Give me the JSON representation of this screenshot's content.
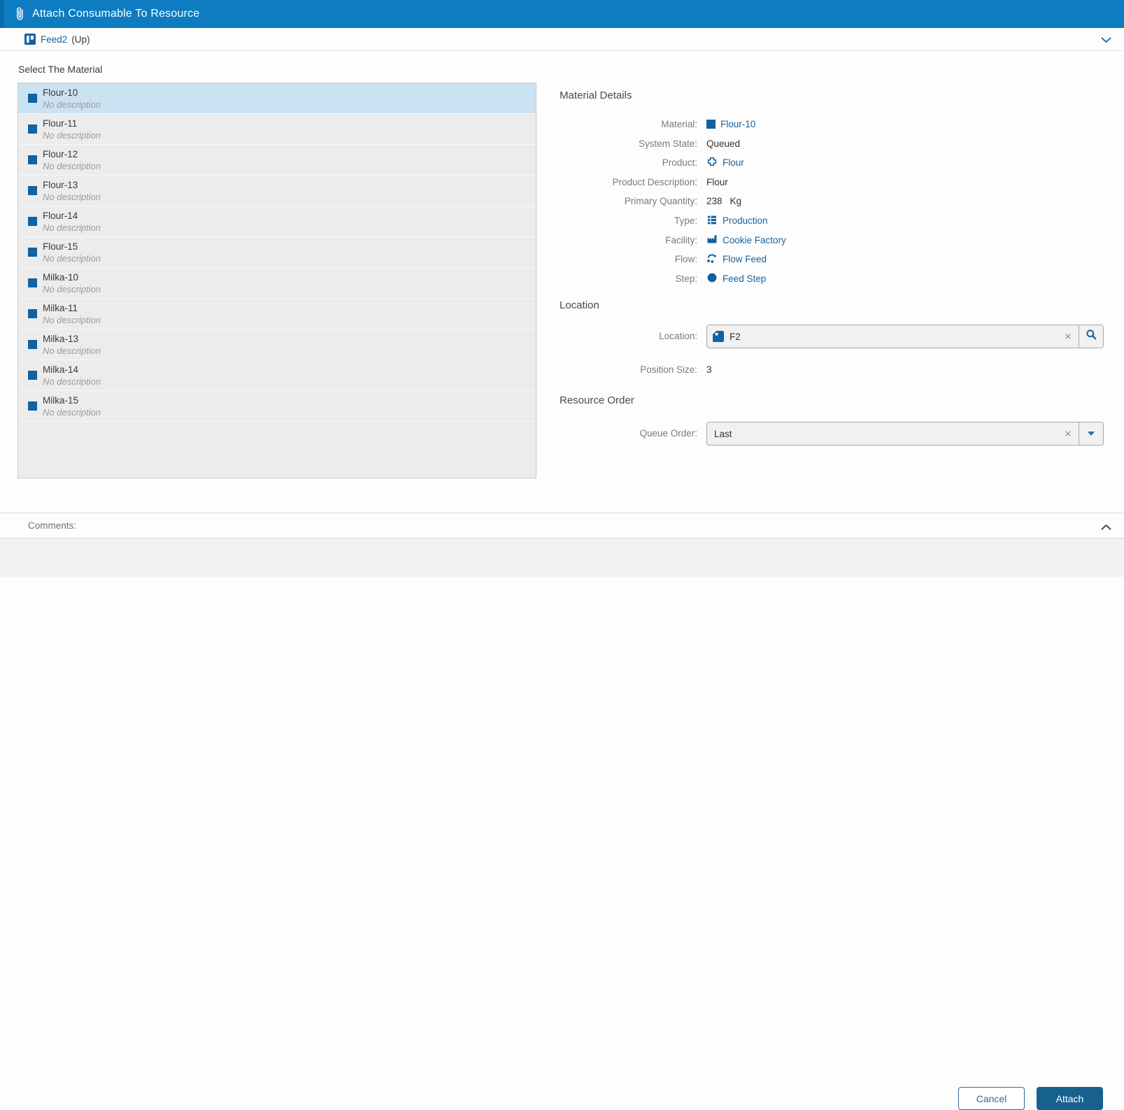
{
  "titlebar": {
    "title": "Attach Consumable To Resource"
  },
  "context": {
    "resource_name": "Feed2",
    "resource_state": "(Up)"
  },
  "materials": {
    "heading": "Select The Material",
    "items": [
      {
        "name": "Flour-10",
        "description": "No description",
        "selected": true
      },
      {
        "name": "Flour-11",
        "description": "No description",
        "selected": false
      },
      {
        "name": "Flour-12",
        "description": "No description",
        "selected": false
      },
      {
        "name": "Flour-13",
        "description": "No description",
        "selected": false
      },
      {
        "name": "Flour-14",
        "description": "No description",
        "selected": false
      },
      {
        "name": "Flour-15",
        "description": "No description",
        "selected": false
      },
      {
        "name": "Milka-10",
        "description": "No description",
        "selected": false
      },
      {
        "name": "Milka-11",
        "description": "No description",
        "selected": false
      },
      {
        "name": "Milka-13",
        "description": "No description",
        "selected": false
      },
      {
        "name": "Milka-14",
        "description": "No description",
        "selected": false
      },
      {
        "name": "Milka-15",
        "description": "No description",
        "selected": false
      }
    ]
  },
  "details": {
    "heading": "Material Details",
    "rows": [
      {
        "label": "Material:",
        "value": "Flour-10",
        "icon": "material-icon",
        "link": true
      },
      {
        "label": "System State:",
        "value": "Queued",
        "icon": "",
        "link": false
      },
      {
        "label": "Product:",
        "value": "Flour",
        "icon": "product-icon",
        "link": true
      },
      {
        "label": "Product Description:",
        "value": "Flour",
        "icon": "",
        "link": false
      },
      {
        "label": "Primary Quantity:",
        "value": "238",
        "unit": "Kg",
        "icon": "",
        "link": false
      },
      {
        "label": "Type:",
        "value": "Production",
        "icon": "type-icon",
        "link": true
      },
      {
        "label": "Facility:",
        "value": "Cookie Factory",
        "icon": "facility-icon",
        "link": true
      },
      {
        "label": "Flow:",
        "value": "Flow Feed",
        "icon": "flow-icon",
        "link": true
      },
      {
        "label": "Step:",
        "value": "Feed Step",
        "icon": "step-icon",
        "link": true
      }
    ]
  },
  "location": {
    "heading": "Location",
    "field_label": "Location:",
    "value": "F2",
    "position_label": "Position Size:",
    "position_value": "3"
  },
  "resource_order": {
    "heading": "Resource Order",
    "field_label": "Queue Order:",
    "value": "Last"
  },
  "comments": {
    "label": "Comments:"
  },
  "footer": {
    "cancel": "Cancel",
    "attach": "Attach"
  },
  "icons": {
    "clear": "×"
  },
  "colors": {
    "titlebar": "#0d7cc1",
    "link_blue": "#15639f",
    "icon_blue": "#12619e",
    "attach_bg": "#17618f",
    "selected_row": "#cbe2f3"
  }
}
